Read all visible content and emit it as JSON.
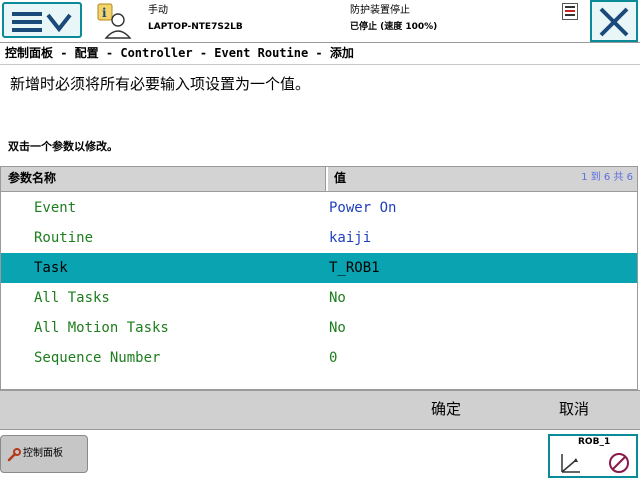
{
  "status": {
    "mode": "手动",
    "system_name": "LAPTOP-NTE7S2LB",
    "safety_state": "防护装置停止",
    "run_state": "已停止 (速度 100%)"
  },
  "breadcrumb": "控制面板 - 配置 - Controller - Event Routine - 添加",
  "instruction": "新增时必须将所有必要输入项设置为一个值。",
  "hint": "双击一个参数以修改。",
  "table": {
    "col_name": "参数名称",
    "col_value": "值",
    "count": "1 到 6 共 6",
    "rows": [
      {
        "name": "Event",
        "value": "Power On"
      },
      {
        "name": "Routine",
        "value": "kaiji"
      },
      {
        "name": "Task",
        "value": "T_ROB1"
      },
      {
        "name": "All Tasks",
        "value": "No"
      },
      {
        "name": "All Motion Tasks",
        "value": "No"
      },
      {
        "name": "Sequence Number",
        "value": "0"
      }
    ]
  },
  "buttons": {
    "ok": "确定",
    "cancel": "取消"
  },
  "taskbar": {
    "control_panel": "控制面板",
    "robot": "ROB_1"
  },
  "icons": {
    "menu": "menu-icon",
    "user": "user-info-icon",
    "program": "program-status-icon",
    "close": "close-icon",
    "wrench": "wrench-icon",
    "axes": "jog-axes-icon",
    "speed": "speed-icon"
  },
  "colors": {
    "accent": "#0aa3b1",
    "name_text": "#1e7d1e",
    "value_text": "#1f3fbf",
    "header_bg": "#d3d3d3"
  }
}
